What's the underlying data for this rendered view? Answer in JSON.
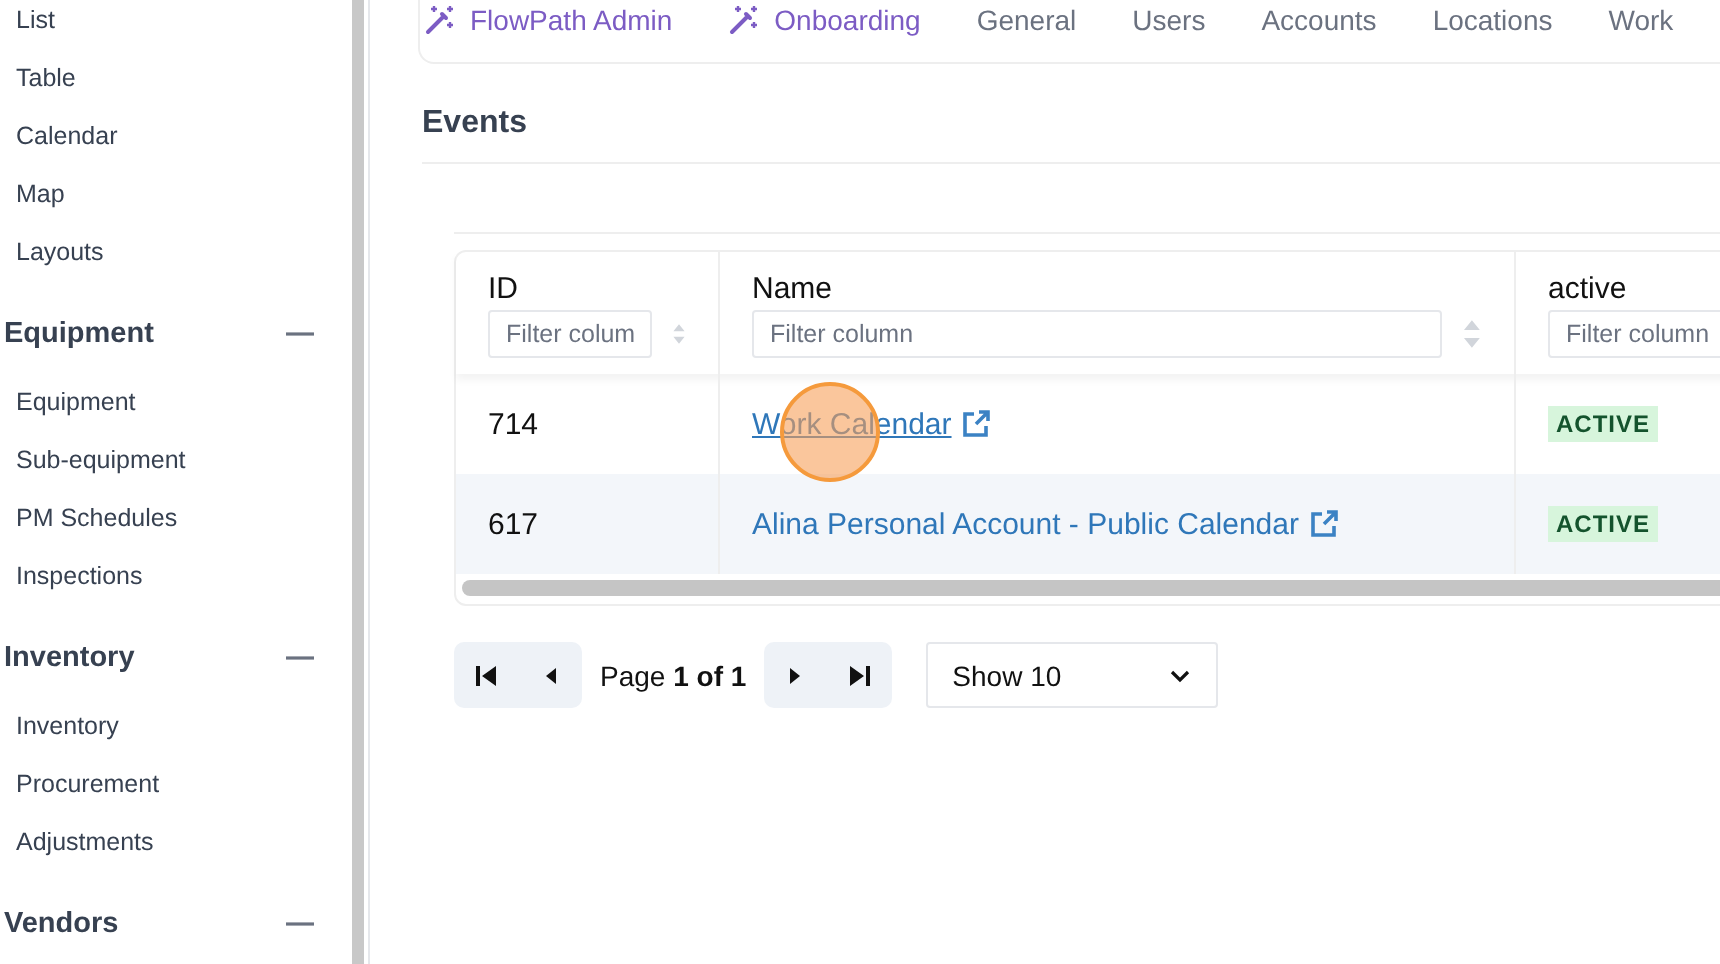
{
  "sidebar": {
    "sections": [
      {
        "items": [
          "List",
          "Table",
          "Calendar",
          "Map",
          "Layouts"
        ]
      },
      {
        "title": "Equipment",
        "expanded": true,
        "items": [
          "Equipment",
          "Sub-equipment",
          "PM Schedules",
          "Inspections"
        ]
      },
      {
        "title": "Inventory",
        "expanded": true,
        "items": [
          "Inventory",
          "Procurement",
          "Adjustments"
        ]
      },
      {
        "title": "Vendors",
        "expanded": true
      }
    ]
  },
  "tabs": [
    {
      "label": "FlowPath Admin",
      "kind": "wizard"
    },
    {
      "label": "Onboarding",
      "kind": "wizard"
    },
    {
      "label": "General",
      "kind": "plain"
    },
    {
      "label": "Users",
      "kind": "plain"
    },
    {
      "label": "Accounts",
      "kind": "plain"
    },
    {
      "label": "Locations",
      "kind": "plain"
    },
    {
      "label": "Work",
      "kind": "plain"
    }
  ],
  "section_title": "Events",
  "table": {
    "columns": [
      {
        "label": "ID",
        "placeholder": "Filter colum",
        "sortable": true
      },
      {
        "label": "Name",
        "placeholder": "Filter column",
        "sortable": true
      },
      {
        "label": "active",
        "placeholder": "Filter column",
        "sortable": false
      }
    ],
    "rows": [
      {
        "id": "714",
        "name": "Work Calendar",
        "hovered": true,
        "status": "ACTIVE"
      },
      {
        "id": "617",
        "name": "Alina Personal Account - Public Calendar",
        "hovered": false,
        "status": "ACTIVE"
      }
    ]
  },
  "pagination": {
    "page_text": "Page **1 of 1**",
    "page_size": "Show 10"
  }
}
